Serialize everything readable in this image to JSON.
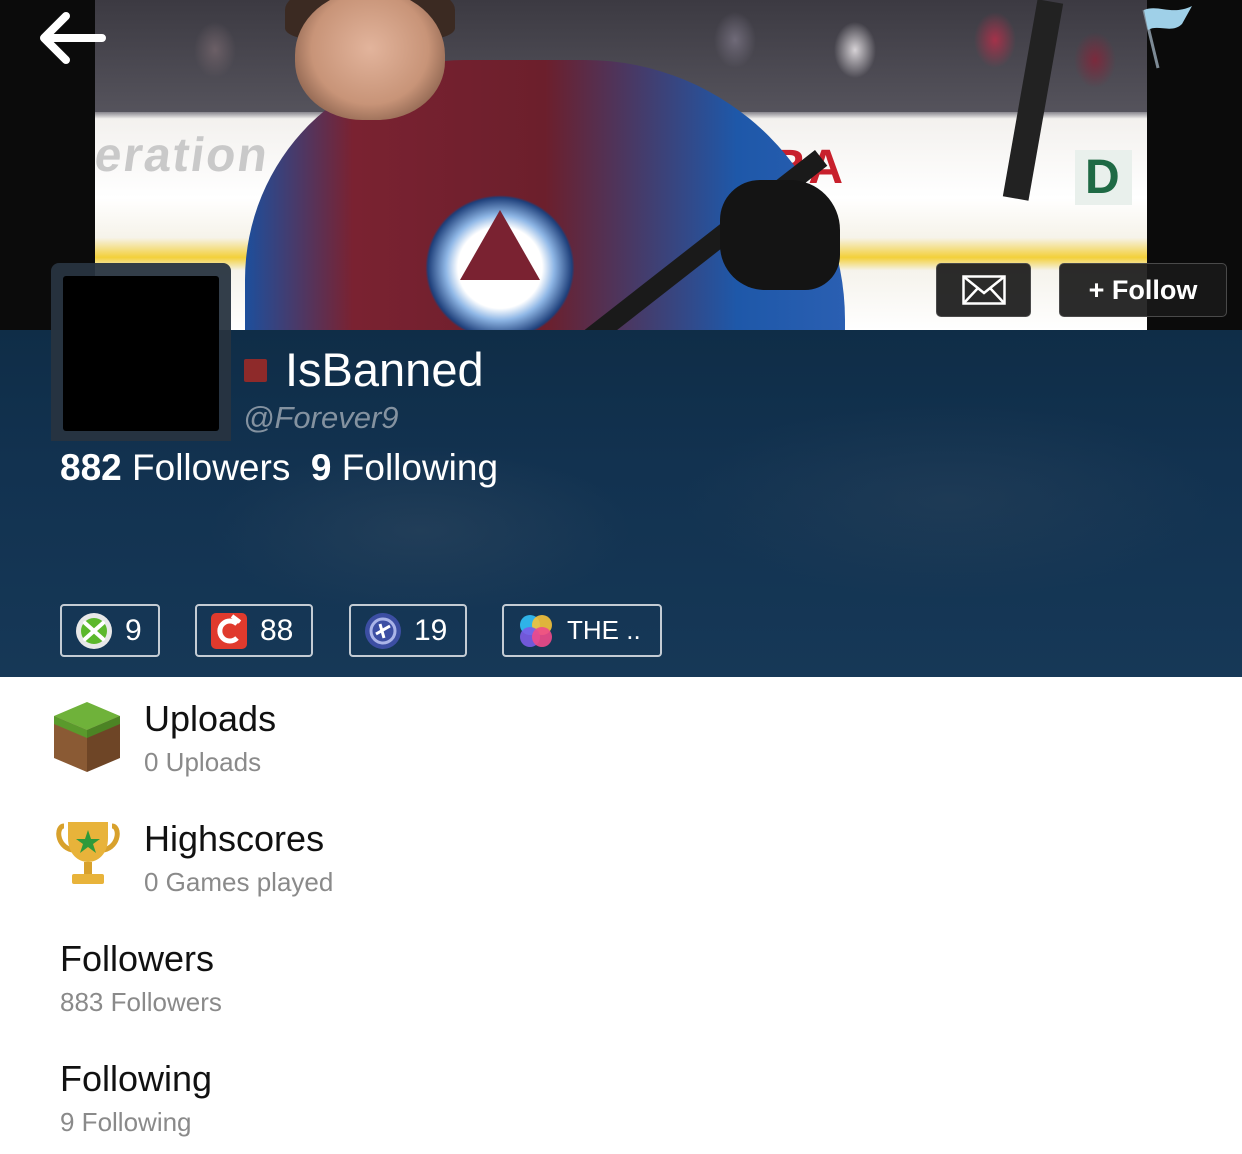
{
  "header": {
    "follow_label": "+ Follow",
    "cover_text_left": "eration",
    "cover_text_mid": "UBA",
    "cover_text_right": "D"
  },
  "profile": {
    "username": "IsBanned",
    "handle": "@Forever9",
    "status_color": "#8e2a2a",
    "followers_count": "882",
    "followers_label": "Followers",
    "following_count": "9",
    "following_label": "Following"
  },
  "accounts": [
    {
      "icon": "xbox-icon",
      "value": "9"
    },
    {
      "icon": "origin-icon",
      "value": "88"
    },
    {
      "icon": "playstation-icon",
      "value": "19"
    },
    {
      "icon": "game-center-icon",
      "value": "THE .."
    }
  ],
  "sections": [
    {
      "icon": "grass-block-icon",
      "title": "Uploads",
      "subtitle": "0 Uploads"
    },
    {
      "icon": "trophy-icon",
      "title": "Highscores",
      "subtitle": "0 Games played"
    },
    {
      "icon": "",
      "title": "Followers",
      "subtitle": "883 Followers"
    },
    {
      "icon": "",
      "title": "Following",
      "subtitle": "9 Following"
    }
  ],
  "colors": {
    "band": "#123250",
    "accent": "#8e2a2a"
  }
}
